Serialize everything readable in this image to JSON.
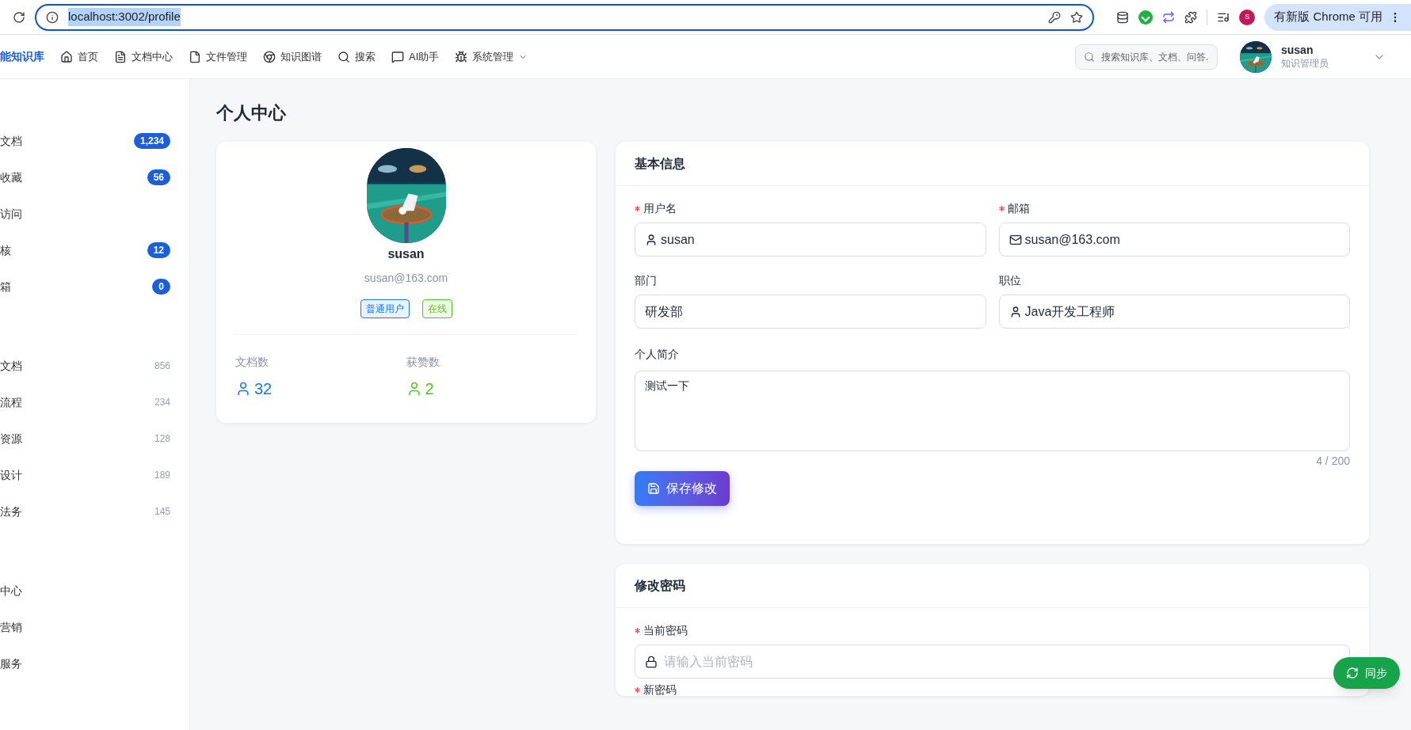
{
  "browser": {
    "url": "localhost:3002/profile",
    "profile_initial": "S",
    "update_button": "有新版 Chrome 可用"
  },
  "navbar": {
    "brand": "能知识库",
    "items": [
      {
        "label": "首页",
        "kind": "home",
        "dropdown": false
      },
      {
        "label": "文档中心",
        "kind": "doc",
        "dropdown": false
      },
      {
        "label": "文件管理",
        "kind": "file",
        "dropdown": false
      },
      {
        "label": "知识图谱",
        "kind": "graph",
        "dropdown": false
      },
      {
        "label": "搜索",
        "kind": "search",
        "dropdown": false
      },
      {
        "label": "AI助手",
        "kind": "chat",
        "dropdown": false
      },
      {
        "label": "系统管理",
        "kind": "system",
        "dropdown": true
      }
    ],
    "search_placeholder": "搜索知识库、文档、问答.",
    "user": {
      "name": "susan",
      "role": "知识管理员"
    }
  },
  "sidebar": {
    "groups": [
      {
        "items": [
          {
            "label": "文档",
            "count": "1,234",
            "kind": "badge"
          },
          {
            "label": "收藏",
            "count": "56",
            "kind": "badge"
          },
          {
            "label": "访问",
            "kind": "plain"
          },
          {
            "label": "核",
            "count": "12",
            "kind": "badge"
          },
          {
            "label": "箱",
            "count": "0",
            "kind": "badge"
          }
        ]
      },
      {
        "items": [
          {
            "label": "文档",
            "count": "856",
            "kind": "count"
          },
          {
            "label": "流程",
            "count": "234",
            "kind": "count"
          },
          {
            "label": "资源",
            "count": "128",
            "kind": "count"
          },
          {
            "label": "设计",
            "count": "189",
            "kind": "count"
          },
          {
            "label": "法务",
            "count": "145",
            "kind": "count"
          }
        ]
      },
      {
        "items": [
          {
            "label": "中心",
            "kind": "plain"
          },
          {
            "label": "营销",
            "kind": "plain"
          },
          {
            "label": "服务",
            "kind": "plain"
          }
        ]
      }
    ]
  },
  "page_title": "个人中心",
  "profile_card": {
    "name": "susan",
    "email": "susan@163.com",
    "tags": [
      {
        "label": "普通用户",
        "color": "#1677ff"
      },
      {
        "label": "在线",
        "color": "#52c41a"
      }
    ],
    "stats": [
      {
        "label": "文档数",
        "value": "32",
        "color": "#1677ff"
      },
      {
        "label": "获赞数",
        "value": "2",
        "color": "#52c41a"
      }
    ]
  },
  "basic_info": {
    "title": "基本信息",
    "fields": [
      {
        "label": "用户名",
        "required": true,
        "value": "susan",
        "kind": "user"
      },
      {
        "label": "邮箱",
        "required": true,
        "value": "susan@163.com",
        "kind": "mail"
      },
      {
        "label": "部门",
        "required": false,
        "value": "研发部",
        "kind": "plain"
      },
      {
        "label": "职位",
        "required": false,
        "value": "Java开发工程师",
        "kind": "user"
      }
    ],
    "bio": {
      "label": "个人简介",
      "value": "测试一下",
      "counter": "4 / 200"
    },
    "save_button": "保存修改"
  },
  "password": {
    "title": "修改密码",
    "fields": [
      {
        "label": "当前密码",
        "required": true,
        "placeholder": "请输入当前密码"
      }
    ],
    "next_label": {
      "label": "新密码",
      "required": true
    }
  },
  "sync_button": "同步"
}
